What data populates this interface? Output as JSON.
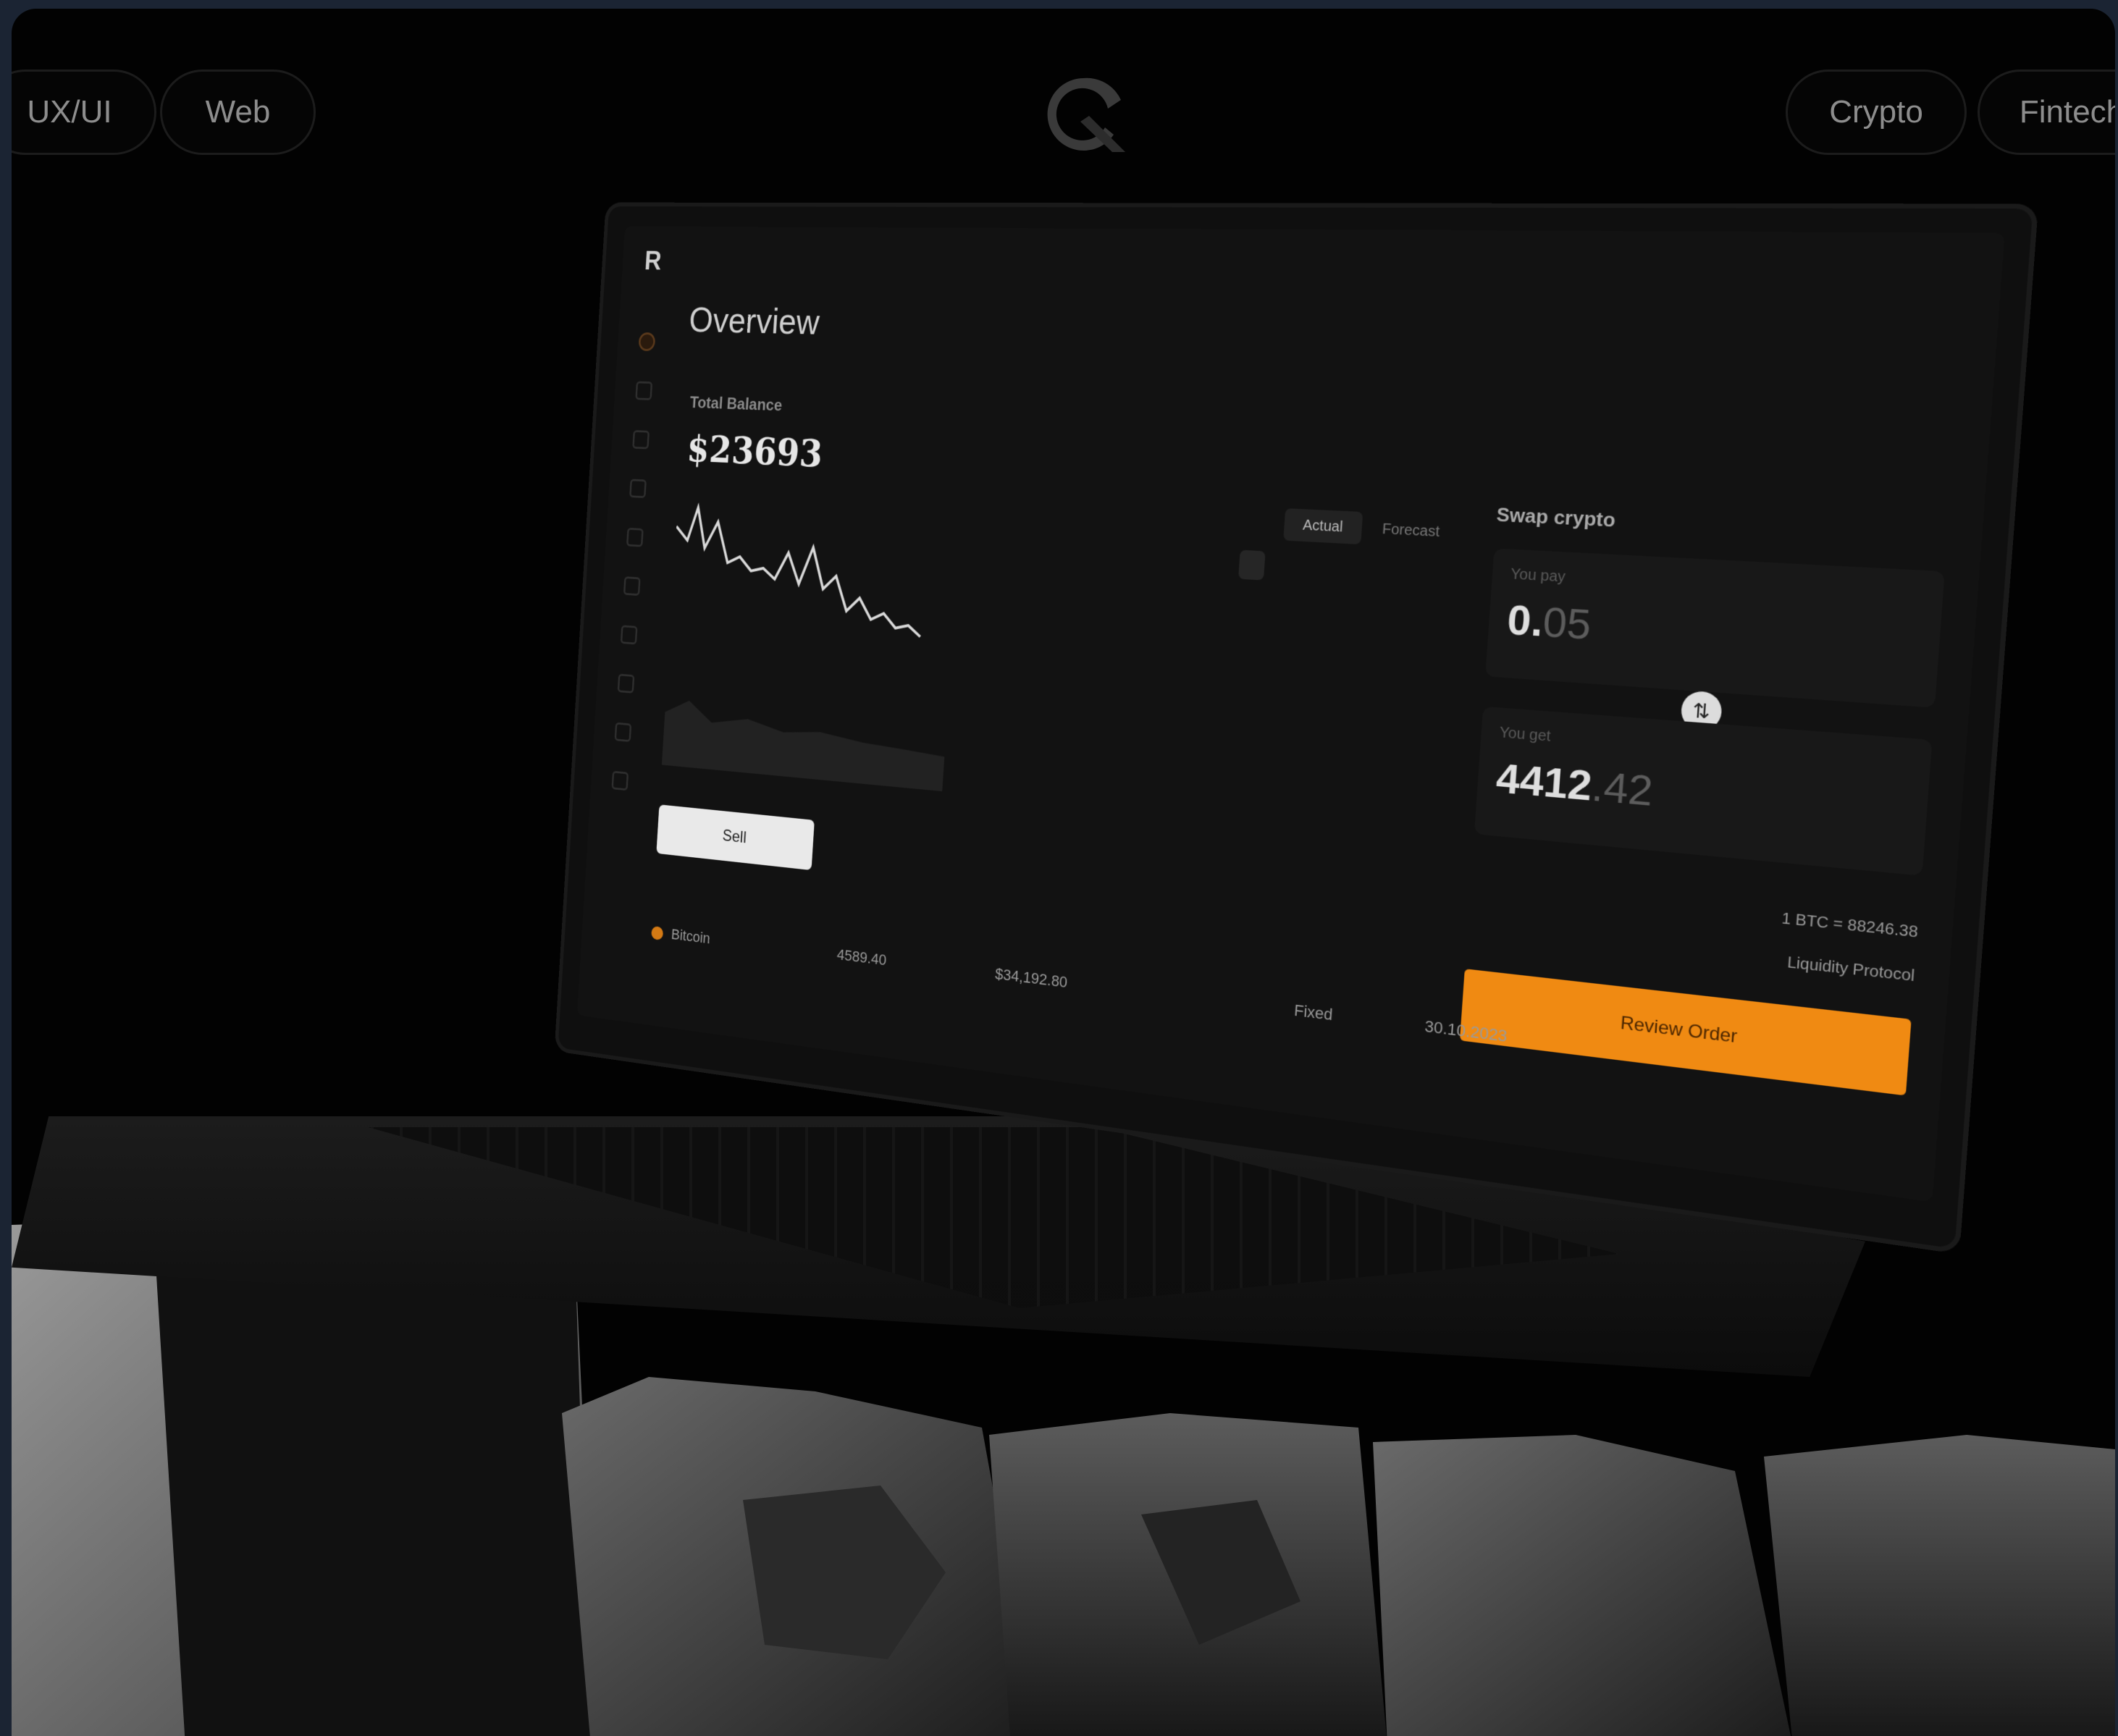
{
  "chips": {
    "left": [
      "UX/UI",
      "Web"
    ],
    "right": [
      "Crypto",
      "Fintech"
    ]
  },
  "brand_logo": "q-logo-icon",
  "dashboard": {
    "app_logo": "R",
    "page_title": "Overview",
    "total_balance_label": "Total Balance",
    "total_balance_value": "$23693",
    "sell_button": "Sell",
    "view_tabs": [
      "Actual",
      "Forecast"
    ],
    "swap": {
      "title": "Swap crypto",
      "pay_label": "You pay",
      "pay_value_main": "0.",
      "pay_value_rest": "05",
      "receive_label": "You get",
      "receive_value_main": "4412",
      "receive_value_rest": ".42",
      "rate_value": "1 BTC = 88246.38",
      "provider_value": "Liquidity Protocol",
      "review_button": "Review Order"
    },
    "table_row": {
      "coin_label": "Bitcoin",
      "amount_value": "4589.40",
      "value_value": "$34,192.80",
      "status_value": "Fixed",
      "date_value": "30.10.2023"
    }
  },
  "colors": {
    "background": "#020202",
    "accent": "#f08a12",
    "frame": "#1b2433"
  }
}
